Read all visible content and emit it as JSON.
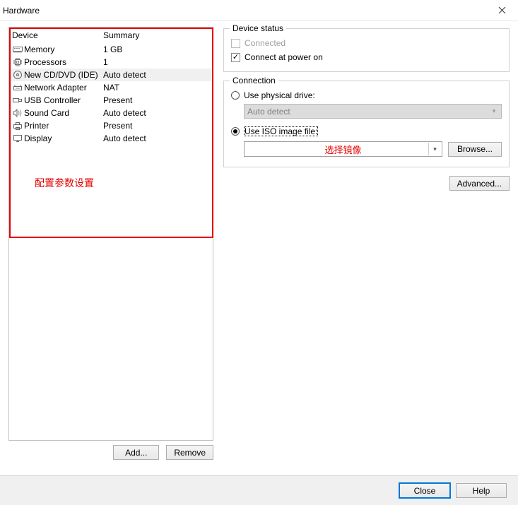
{
  "window": {
    "title": "Hardware"
  },
  "device_list": {
    "headers": {
      "device": "Device",
      "summary": "Summary"
    },
    "rows": [
      {
        "name": "Memory",
        "summary": "1 GB",
        "icon": "memory-icon",
        "selected": false
      },
      {
        "name": "Processors",
        "summary": "1",
        "icon": "cpu-icon",
        "selected": false
      },
      {
        "name": "New CD/DVD (IDE)",
        "summary": "Auto detect",
        "icon": "cd-icon",
        "selected": true
      },
      {
        "name": "Network Adapter",
        "summary": "NAT",
        "icon": "network-icon",
        "selected": false
      },
      {
        "name": "USB Controller",
        "summary": "Present",
        "icon": "usb-icon",
        "selected": false
      },
      {
        "name": "Sound Card",
        "summary": "Auto detect",
        "icon": "sound-icon",
        "selected": false
      },
      {
        "name": "Printer",
        "summary": "Present",
        "icon": "printer-icon",
        "selected": false
      },
      {
        "name": "Display",
        "summary": "Auto detect",
        "icon": "display-icon",
        "selected": false
      }
    ],
    "annotation": "配置参数设置"
  },
  "left_buttons": {
    "add": "Add...",
    "remove": "Remove"
  },
  "device_status": {
    "legend": "Device status",
    "connected_label": "Connected",
    "connected_checked": false,
    "connected_enabled": false,
    "power_on_label": "Connect at power on",
    "power_on_checked": true
  },
  "connection": {
    "legend": "Connection",
    "physical_label": "Use physical drive:",
    "physical_selected": false,
    "physical_value": "Auto detect",
    "iso_label": "Use ISO image file:",
    "iso_selected": true,
    "iso_value": "",
    "iso_placeholder": "选择镜像",
    "browse": "Browse..."
  },
  "advanced": "Advanced...",
  "footer": {
    "close": "Close",
    "help": "Help"
  }
}
